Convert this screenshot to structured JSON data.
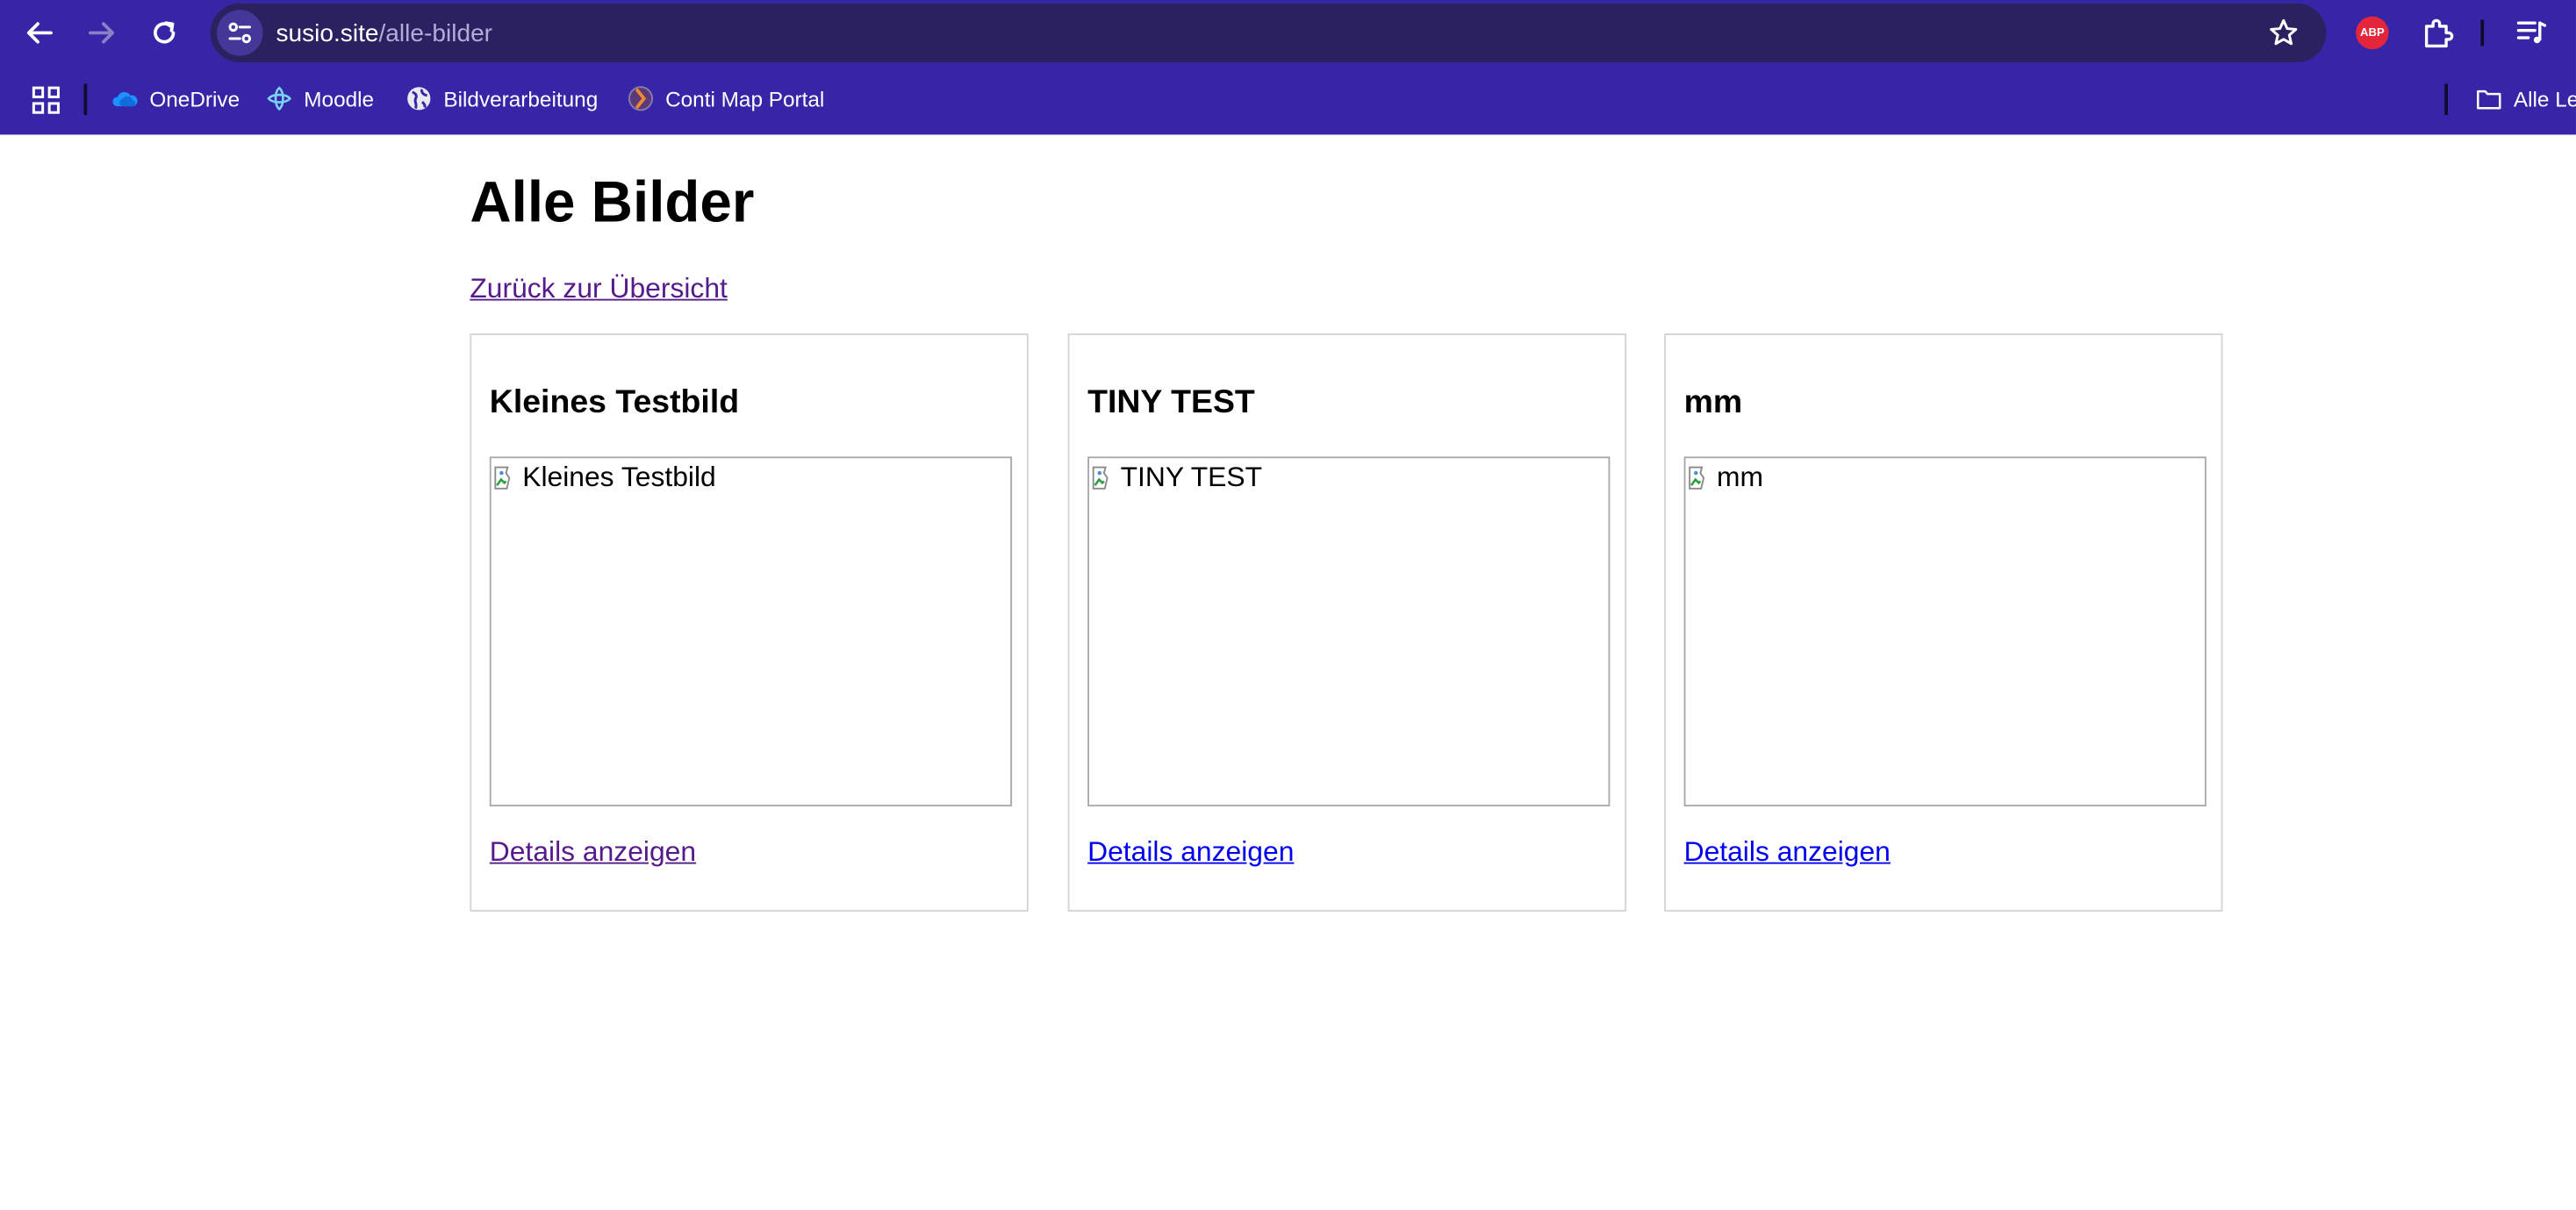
{
  "browser": {
    "url_host": "susio.site",
    "url_path": "/alle-bilder",
    "extension_abp_label": "ABP",
    "bookmarks": [
      {
        "label": "OneDrive",
        "icon": "onedrive-icon"
      },
      {
        "label": "Moodle",
        "icon": "moodle-icon"
      },
      {
        "label": "Bildverarbeitung",
        "icon": "globe-icon"
      },
      {
        "label": "Conti Map Portal",
        "icon": "map-portal-icon"
      }
    ],
    "other_bookmarks_label": "Alle Lesezeichen"
  },
  "page": {
    "title": "Alle Bilder",
    "back_link": "Zurück zur Übersicht",
    "cards": [
      {
        "title": "Kleines Testbild",
        "image_alt": "Kleines Testbild",
        "link": "Details anzeigen",
        "link_visited": true
      },
      {
        "title": "TINY TEST",
        "image_alt": "TINY TEST",
        "link": "Details anzeigen",
        "link_visited": false
      },
      {
        "title": "mm",
        "image_alt": "mm",
        "link": "Details anzeigen",
        "link_visited": false
      }
    ]
  },
  "colors": {
    "chrome_bg": "#3725a8",
    "omnibox_bg": "#2c2160",
    "visited_link": "#551a8b",
    "link": "#0000ee"
  }
}
